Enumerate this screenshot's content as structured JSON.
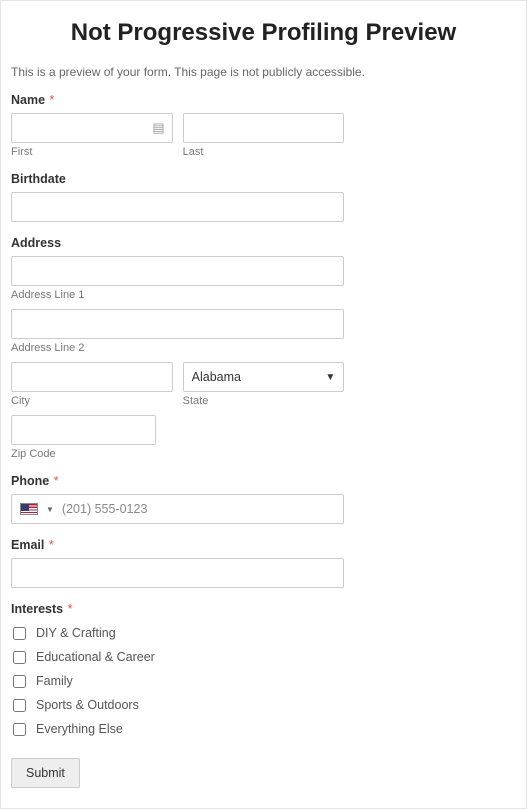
{
  "title": "Not Progressive Profiling Preview",
  "previewNote": "This is a preview of your form. This page is not publicly accessible.",
  "name": {
    "label": "Name",
    "required": "*",
    "firstSub": "First",
    "lastSub": "Last"
  },
  "birthdate": {
    "label": "Birthdate"
  },
  "address": {
    "label": "Address",
    "line1Sub": "Address Line 1",
    "line2Sub": "Address Line 2",
    "citySub": "City",
    "stateSub": "State",
    "stateValue": "Alabama",
    "zipSub": "Zip Code"
  },
  "phone": {
    "label": "Phone",
    "required": "*",
    "placeholder": "(201) 555-0123"
  },
  "email": {
    "label": "Email",
    "required": "*"
  },
  "interests": {
    "label": "Interests",
    "required": "*",
    "options": {
      "o0": "DIY & Crafting",
      "o1": "Educational & Career",
      "o2": "Family",
      "o3": "Sports & Outdoors",
      "o4": "Everything Else"
    }
  },
  "submit": "Submit"
}
